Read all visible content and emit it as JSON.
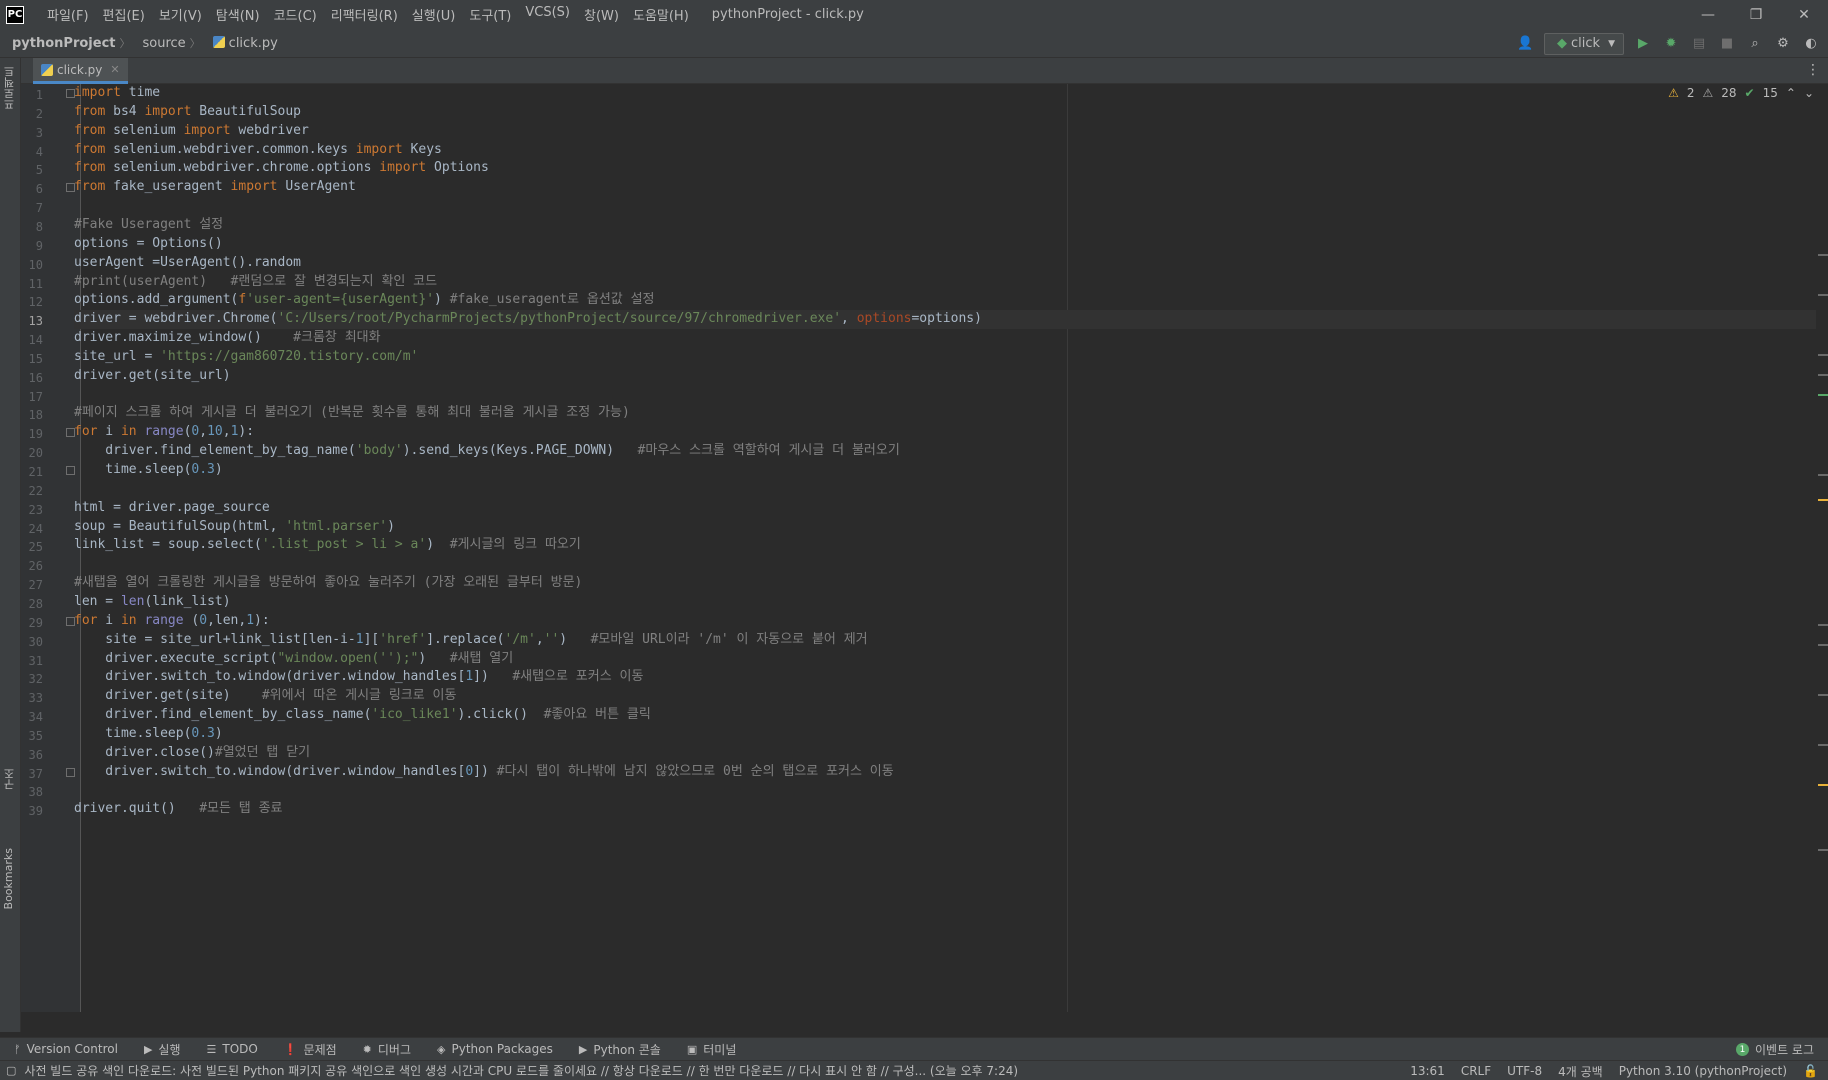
{
  "titlebar": {
    "logo": "PC",
    "menu": [
      "파일(F)",
      "편집(E)",
      "보기(V)",
      "탐색(N)",
      "코드(C)",
      "리팩터링(R)",
      "실행(U)",
      "도구(T)",
      "VCS(S)",
      "창(W)",
      "도움말(H)"
    ],
    "title": "pythonProject - click.py",
    "controls": [
      "—",
      "❐",
      "✕"
    ]
  },
  "navbar": {
    "crumbs": [
      "pythonProject",
      "source",
      "click.py"
    ],
    "run_config": "click"
  },
  "left_strip": {
    "top_label": "프로젝트",
    "bottom_labels": [
      "구조",
      "Bookmarks"
    ]
  },
  "tab": {
    "label": "click.py"
  },
  "inspections": {
    "warnings": "2",
    "weak_warnings": "28",
    "ok": "15"
  },
  "editor": {
    "current_line": 13,
    "lines": [
      "import time",
      "from bs4 import BeautifulSoup",
      "from selenium import webdriver",
      "from selenium.webdriver.common.keys import Keys",
      "from selenium.webdriver.chrome.options import Options",
      "from fake_useragent import UserAgent",
      "",
      "#Fake Useragent 설정",
      "options = Options()",
      "userAgent =UserAgent().random",
      "#print(userAgent)   #랜덤으로 잘 변경되는지 확인 코드",
      "options.add_argument(f'user-agent={userAgent}') #fake_useragent로 옵션값 설정",
      "driver = webdriver.Chrome('C:/Users/root/PycharmProjects/pythonProject/source/97/chromedriver.exe', options=options)",
      "driver.maximize_window()    #크롬창 최대화",
      "site_url = 'https://gam860720.tistory.com/m'",
      "driver.get(site_url)",
      "",
      "#페이지 스크롤 하여 게시글 더 불러오기 (반복문 횟수를 통해 최대 불러올 게시글 조정 가능)",
      "for i in range(0,10,1):",
      "    driver.find_element_by_tag_name('body').send_keys(Keys.PAGE_DOWN)   #마우스 스크롤 역할하여 게시글 더 불러오기",
      "    time.sleep(0.3)",
      "",
      "html = driver.page_source",
      "soup = BeautifulSoup(html, 'html.parser')",
      "link_list = soup.select('.list_post > li > a')  #게시글의 링크 따오기",
      "",
      "#새탭을 열어 크롤링한 게시글을 방문하여 좋아요 눌러주기 (가장 오래된 글부터 방문)",
      "len = len(link_list)",
      "for i in range (0,len,1):",
      "    site = site_url+link_list[len-i-1]['href'].replace('/m','')   #모바일 URL이라 '/m' 이 자동으로 붙어 제거",
      "    driver.execute_script(\"window.open('');\")   #새탭 열기",
      "    driver.switch_to.window(driver.window_handles[1])   #새탭으로 포커스 이동",
      "    driver.get(site)    #위에서 따온 게시글 링크로 이동",
      "    driver.find_element_by_class_name('ico_like1').click()  #좋아요 버튼 클릭",
      "    time.sleep(0.3)",
      "    driver.close()#열었던 탭 닫기",
      "    driver.switch_to.window(driver.window_handles[0]) #다시 탭이 하나밖에 남지 않았으므로 0번 순의 탭으로 포커스 이동",
      "",
      "driver.quit()   #모든 탭 종료"
    ],
    "fold_lines": [
      1,
      6,
      19,
      21,
      29,
      37
    ]
  },
  "syntax_colors": {
    "keyword": "#cc7832",
    "string": "#6a8759",
    "comment": "#808080",
    "number": "#6897bb",
    "builtin": "#8888c6",
    "kwarg": "#aa4926",
    "default": "#a9b7c6"
  },
  "bottom_tools": [
    {
      "icon": "ᚠ",
      "label": "Version Control"
    },
    {
      "icon": "▶",
      "label": "실행"
    },
    {
      "icon": "☰",
      "label": "TODO"
    },
    {
      "icon": "❗",
      "label": "문제점"
    },
    {
      "icon": "✹",
      "label": "디버그"
    },
    {
      "icon": "◈",
      "label": "Python Packages"
    },
    {
      "icon": "▶",
      "label": "Python 콘솔"
    },
    {
      "icon": "▣",
      "label": "터미널"
    }
  ],
  "event_log": {
    "count": "1",
    "label": "이벤트 로그"
  },
  "status": {
    "message": "사전 빌드 공유 색인 다운로드: 사전 빌드된 Python 패키지 공유 색인으로 색인 생성 시간과 CPU 로드를 줄이세요 // 항상 다운로드 // 한 번만 다운로드 // 다시 표시 안 함 // 구성... (오늘 오후 7:24)",
    "position": "13:61",
    "line_sep": "CRLF",
    "encoding": "UTF-8",
    "indent": "4개 공백",
    "interpreter": "Python 3.10 (pythonProject)"
  }
}
